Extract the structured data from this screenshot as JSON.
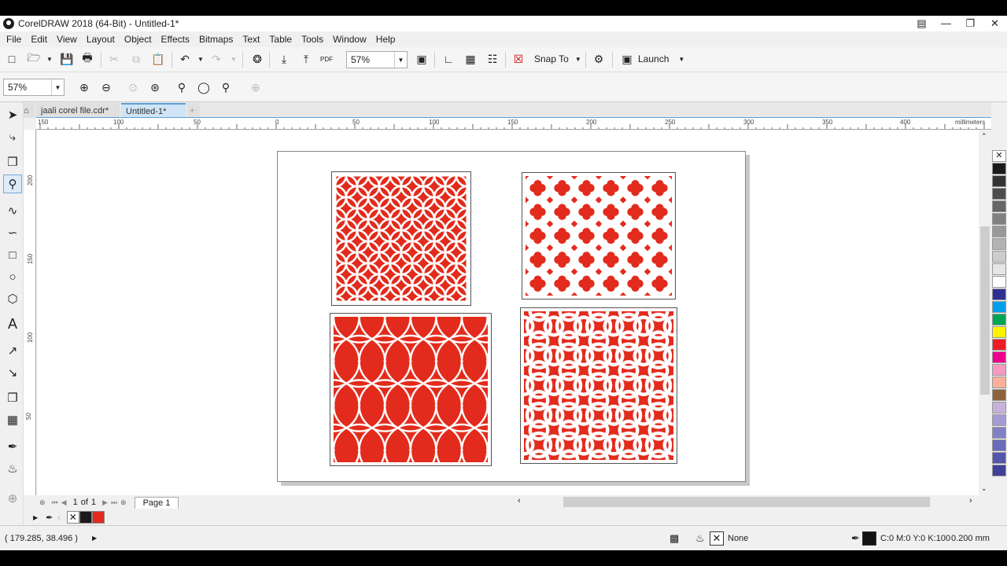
{
  "window": {
    "title": "CorelDRAW 2018 (64-Bit) - Untitled-1*"
  },
  "menu": [
    "File",
    "Edit",
    "View",
    "Layout",
    "Object",
    "Effects",
    "Bitmaps",
    "Text",
    "Table",
    "Tools",
    "Window",
    "Help"
  ],
  "toolbar": {
    "zoom_value": "57%",
    "snap_label": "Snap To",
    "launch_label": "Launch",
    "pdf_label": "PDF"
  },
  "propbar": {
    "zoom_value": "57%"
  },
  "tabs": [
    {
      "label": "jaali corel file.cdr*"
    },
    {
      "label": "Untitled-1*"
    }
  ],
  "ruler": {
    "h_labels": [
      "150",
      "100",
      "50",
      "0",
      "50",
      "100",
      "150",
      "200",
      "250",
      "300",
      "350",
      "400"
    ],
    "units": "millimeters",
    "v_labels": [
      "200",
      "150",
      "100",
      "50"
    ]
  },
  "pagenav": {
    "current": "1",
    "of_label": "of",
    "total": "1",
    "page_tab": "Page 1"
  },
  "status": {
    "coords": "( 179.285, 38.496 )",
    "fill_label": "None",
    "outline_color": "C:0 M:0 Y:0 K:100",
    "outline_width": "0.200 mm"
  },
  "colors": {
    "accent_red": "#e22b1c"
  },
  "palette": [
    "#1a1a1a",
    "#333333",
    "#4d4d4d",
    "#666666",
    "#808080",
    "#999999",
    "#b3b3b3",
    "#cccccc",
    "#e6e6e6",
    "#ffffff",
    "#2e3192",
    "#00a0e9",
    "#00a651",
    "#fff200",
    "#ed1c24",
    "#ec008c",
    "#f49ac1",
    "#fbaf99",
    "#8c6239",
    "#c7b2de",
    "#a69ad6",
    "#8181c7",
    "#6a6ab8",
    "#5555aa",
    "#40409a"
  ]
}
